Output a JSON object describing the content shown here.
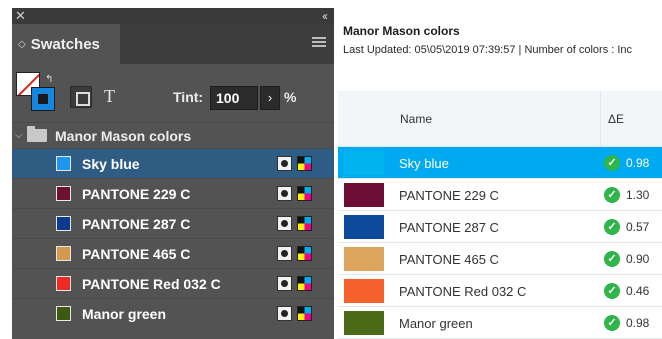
{
  "panel": {
    "title": "Swatches",
    "close_icon": "close-icon",
    "collapse_label": "‹‹",
    "tint_label": "Tint:",
    "tint_value": "100",
    "tint_arrow": "›",
    "tint_unit": "%",
    "text_format_label": "T",
    "group_name": "Manor Mason colors",
    "swatches": [
      {
        "name": "Sky blue",
        "color": "#1e96f0",
        "selected": true
      },
      {
        "name": "PANTONE 229 C",
        "color": "#6d1233",
        "selected": false
      },
      {
        "name": "PANTONE 287 C",
        "color": "#0c3a8c",
        "selected": false
      },
      {
        "name": "PANTONE 465 C",
        "color": "#d39a4d",
        "selected": false
      },
      {
        "name": "PANTONE Red 032 C",
        "color": "#ef2b24",
        "selected": false
      },
      {
        "name": "Manor green",
        "color": "#3c5a12",
        "selected": false
      }
    ]
  },
  "report": {
    "title": "Manor Mason colors",
    "subtitle": "Last Updated: 05\\05\\2019 07:39:57 | Number of colors : Inc",
    "col_name": "Name",
    "col_delta": "ΔE",
    "rows": [
      {
        "name": "Sky blue",
        "color": "#00b4ee",
        "delta": "0.98",
        "selected": true
      },
      {
        "name": "PANTONE 229 C",
        "color": "#6d0f35",
        "delta": "1.30",
        "selected": false
      },
      {
        "name": "PANTONE 287 C",
        "color": "#0d4a9a",
        "delta": "0.57",
        "selected": false
      },
      {
        "name": "PANTONE 465 C",
        "color": "#dca45c",
        "delta": "0.90",
        "selected": false
      },
      {
        "name": "PANTONE Red 032 C",
        "color": "#f5612c",
        "delta": "0.46",
        "selected": false
      },
      {
        "name": "Manor green",
        "color": "#4c6a18",
        "delta": "0.98",
        "selected": false
      }
    ]
  }
}
